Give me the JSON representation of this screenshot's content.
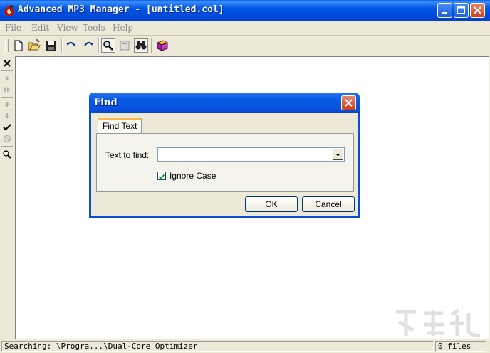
{
  "window": {
    "title": "Advanced MP3 Manager - [untitled.col]"
  },
  "menu": {
    "items": [
      "File",
      "Edit",
      "View",
      "Tools",
      "Help"
    ]
  },
  "toolbar": {
    "buttons": [
      "new-file-icon",
      "open-folder-icon",
      "save-icon",
      "undo-icon",
      "redo-icon",
      "find-icon",
      "properties-icon",
      "binoculars-icon",
      "book-icon"
    ],
    "pressed": "find-icon"
  },
  "left_toolbar": {
    "buttons": [
      "close-x-icon",
      "play-icon",
      "play-next-icon",
      "arrow-up-icon",
      "arrow-down-icon",
      "checkmark-icon",
      "no-icon",
      "search-icon"
    ]
  },
  "dialog": {
    "title": "Find",
    "tab_label": "Find Text",
    "text_to_find_label": "Text to find:",
    "text_value": "",
    "ignore_case_label": "Ignore Case",
    "ignore_case_checked": true,
    "ok_label": "OK",
    "cancel_label": "Cancel"
  },
  "status": {
    "left": "Searching: \\Progra...\\Dual-Core Optimizer",
    "right": "0 files"
  },
  "colors": {
    "titlebar": "#0055e5",
    "accent_tab": "#f9b946",
    "close_red": "#c8401e"
  }
}
